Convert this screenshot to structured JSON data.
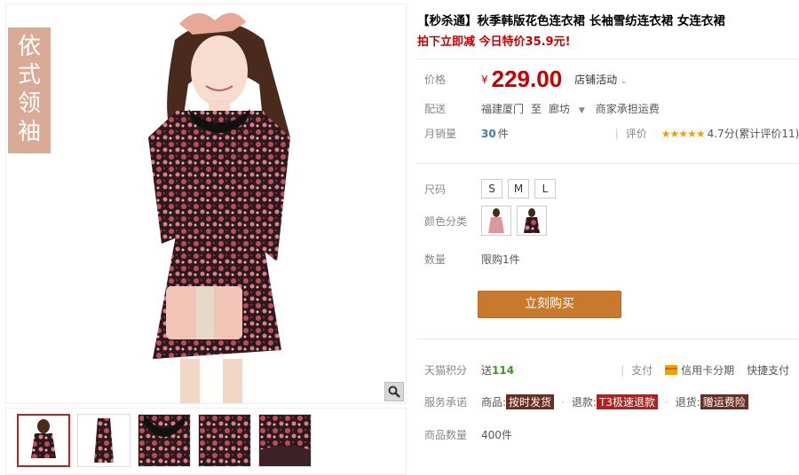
{
  "gallery": {
    "brand_tag": "依式领袖",
    "zoom_icon": "magnifier-icon",
    "thumbnails": [
      "model-front",
      "model-side",
      "collar-detail",
      "fabric-detail",
      "hem-detail"
    ]
  },
  "product": {
    "title": "【秒杀通】秋季韩版花色连衣裙 长袖雪纺连衣裙 女连衣裙",
    "subtitle": "拍下立即减 今日特价35.9元!"
  },
  "price": {
    "label": "价格",
    "currency": "¥",
    "value": "229.00",
    "shop_activity": "店铺活动"
  },
  "delivery": {
    "label": "配送",
    "from": "福建厦门",
    "to_word": "至",
    "to": "廊坊",
    "freight": "商家承担运费"
  },
  "sales": {
    "label": "月销量",
    "count": "30",
    "unit": "件",
    "rating_label": "评价",
    "stars": "★★★★★",
    "rating": "4.7分(累计评价11)"
  },
  "options": {
    "size_label": "尺码",
    "sizes": [
      "S",
      "M",
      "L"
    ],
    "color_label": "颜色分类",
    "quantity_label": "数量",
    "limit": "限购1件"
  },
  "buy_button": "立刻购买",
  "points": {
    "label": "天猫积分",
    "send": "送",
    "amount": "114",
    "pay_label": "支付",
    "credit": "信用卡分期",
    "quick": "快捷支付"
  },
  "service": {
    "label": "服务承诺",
    "item1_prefix": "商品:",
    "item1": "按时发货",
    "item2_prefix": "退款:",
    "item2": "T3极速退款",
    "item3_prefix": "退货:",
    "item3": "赠运费险"
  },
  "stock": {
    "label": "商品数量",
    "value": "400件"
  },
  "colors": {
    "accent": "#c40000",
    "buy": "#c8792d",
    "brand_tag": "#d9ab96"
  }
}
